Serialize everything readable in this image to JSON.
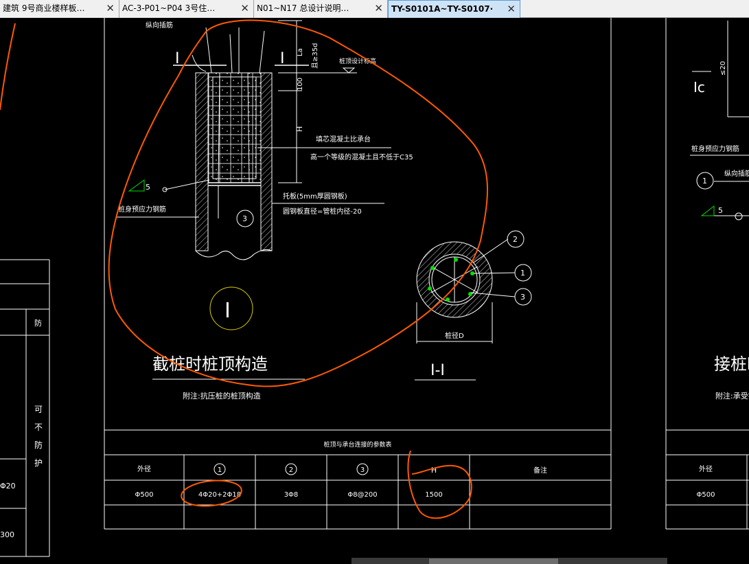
{
  "tabs": [
    {
      "label": "建筑 9号商业楼样板…",
      "active": false
    },
    {
      "label": "AC-3-P01~P04 3号住…",
      "active": false
    },
    {
      "label": "N01~N17 总设计说明…",
      "active": false
    },
    {
      "label": "TY-S0101A~TY-S0107·",
      "active": true
    }
  ],
  "close_glyph": "✕",
  "drawing": {
    "top_note": "纵向插筋",
    "section_mark": "I",
    "dim_la": "La",
    "dim_35d": "且≥35d",
    "dim_100": "100",
    "dim_h": "H",
    "pile_top_level": "桩顶设计标高",
    "fill_note_1": "填芯混凝土比承台",
    "fill_note_2": "高一个等级的混凝土且不低于C35",
    "weld_size": "5",
    "prestress_bar": "桩身预应力钢筋",
    "plate_note_1": "托板(5mm厚圆钢板)",
    "plate_note_2": "圆钢板直径=管桩内径-20",
    "callout_1": "1",
    "callout_2": "2",
    "callout_3": "3",
    "roman_label": "I",
    "pile_dia": "桩径D",
    "section_title": "I-I",
    "detail_title": "截桩时桩顶构造",
    "detail_note": "附注:抗压桩的桩顶构造",
    "right_title": "接桩时",
    "right_note": "附注:承受钢",
    "right_dim": "≤20",
    "right_ic": "Ic",
    "right_label_1": "桩身预应力钢筋",
    "right_label_2": "纵向插筋",
    "right_weld": "5",
    "right_callout": "1",
    "left_col_1": "可",
    "left_col_2": "不",
    "left_col_3": "防",
    "left_col_4": "护",
    "left_head_a": "",
    "left_head_b": "防",
    "left_val_1": "Φ20",
    "left_val_2": "300"
  },
  "table": {
    "title": "桩顶与承台连接的参数表",
    "headers": [
      "外径",
      "1",
      "2",
      "3",
      "H",
      "备注"
    ],
    "row": [
      "Φ500",
      "4Φ20+2Φ18",
      "3Φ8",
      "Φ8@200",
      "1500",
      ""
    ]
  },
  "right_table": {
    "header": "外径",
    "value": "Φ500"
  },
  "colors": {
    "background": "#000000",
    "lines": "#ffffff",
    "annotation": "#ff5a00",
    "highlight_circle": "#d8d000",
    "green_mark": "#00e000"
  }
}
